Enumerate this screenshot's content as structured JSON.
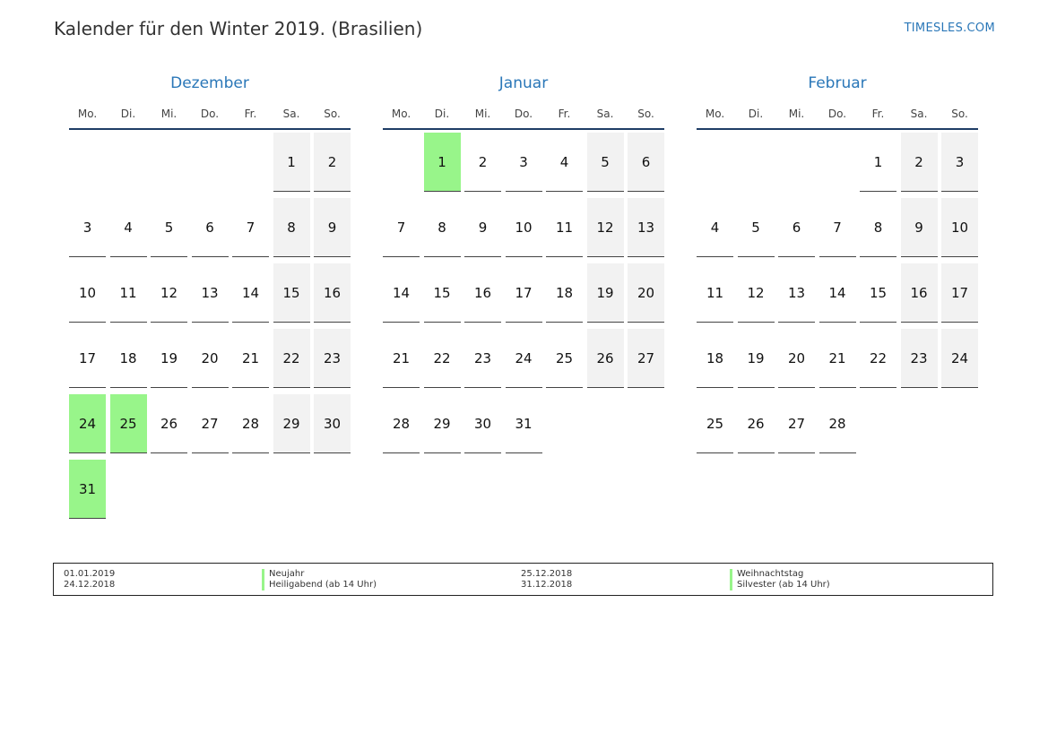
{
  "title": "Kalender für den Winter 2019. (Brasilien)",
  "site": "TIMESLES.COM",
  "colors": {
    "accent": "#2a77b8",
    "holiday": "#98f58a",
    "weekend": "#f2f2f2",
    "rule": "#1f3d66"
  },
  "weekdays": [
    "Mo.",
    "Di.",
    "Mi.",
    "Do.",
    "Fr.",
    "Sa.",
    "So."
  ],
  "months": [
    {
      "name": "Dezember",
      "weeks": [
        [
          "",
          "",
          "",
          "",
          "",
          "1",
          "2"
        ],
        [
          "3",
          "4",
          "5",
          "6",
          "7",
          "8",
          "9"
        ],
        [
          "10",
          "11",
          "12",
          "13",
          "14",
          "15",
          "16"
        ],
        [
          "17",
          "18",
          "19",
          "20",
          "21",
          "22",
          "23"
        ],
        [
          "24",
          "25",
          "26",
          "27",
          "28",
          "29",
          "30"
        ],
        [
          "31",
          "",
          "",
          "",
          "",
          "",
          ""
        ]
      ],
      "holidays": [
        "24",
        "25",
        "31"
      ]
    },
    {
      "name": "Januar",
      "weeks": [
        [
          "",
          "1",
          "2",
          "3",
          "4",
          "5",
          "6"
        ],
        [
          "7",
          "8",
          "9",
          "10",
          "11",
          "12",
          "13"
        ],
        [
          "14",
          "15",
          "16",
          "17",
          "18",
          "19",
          "20"
        ],
        [
          "21",
          "22",
          "23",
          "24",
          "25",
          "26",
          "27"
        ],
        [
          "28",
          "29",
          "30",
          "31",
          "",
          "",
          ""
        ]
      ],
      "holidays": [
        "1"
      ]
    },
    {
      "name": "Februar",
      "weeks": [
        [
          "",
          "",
          "",
          "",
          "1",
          "2",
          "3"
        ],
        [
          "4",
          "5",
          "6",
          "7",
          "8",
          "9",
          "10"
        ],
        [
          "11",
          "12",
          "13",
          "14",
          "15",
          "16",
          "17"
        ],
        [
          "18",
          "19",
          "20",
          "21",
          "22",
          "23",
          "24"
        ],
        [
          "25",
          "26",
          "27",
          "28",
          "",
          "",
          ""
        ]
      ],
      "holidays": []
    }
  ],
  "legend": [
    {
      "date": "01.01.2019",
      "name": "Neujahr"
    },
    {
      "date": "24.12.2018",
      "name": "Heiligabend (ab 14 Uhr)"
    },
    {
      "date": "25.12.2018",
      "name": "Weihnachtstag"
    },
    {
      "date": "31.12.2018",
      "name": "Silvester (ab 14 Uhr)"
    }
  ]
}
